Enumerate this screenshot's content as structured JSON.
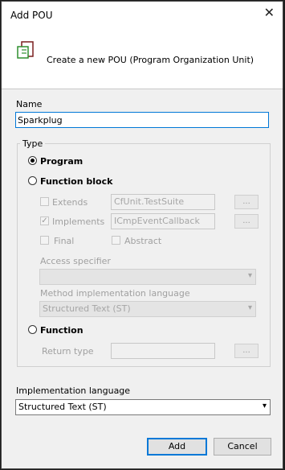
{
  "dialog": {
    "title": "Add POU",
    "close_glyph": "✕",
    "header_text": "Create a new POU (Program Organization Unit)",
    "icon": "pou-icon"
  },
  "name": {
    "label": "Name",
    "value": "Sparkplug"
  },
  "type": {
    "legend": "Type",
    "program_label": "Program",
    "function_block_label": "Function block",
    "extends_label": "Extends",
    "extends_value": "CfUnit.TestSuite",
    "implements_label": "Implements",
    "implements_value": "ICmpEventCallback",
    "final_label": "Final",
    "abstract_label": "Abstract",
    "access_specifier_label": "Access specifier",
    "access_specifier_value": "",
    "method_impl_label": "Method implementation language",
    "method_impl_value": "Structured Text (ST)",
    "function_label": "Function",
    "return_type_label": "Return type",
    "return_type_value": "",
    "browse_label": "...",
    "selected": "Program"
  },
  "implementation_language": {
    "label": "Implementation language",
    "value": "Structured Text (ST)"
  },
  "buttons": {
    "add": "Add",
    "cancel": "Cancel"
  },
  "colors": {
    "accent": "#0078d7"
  }
}
